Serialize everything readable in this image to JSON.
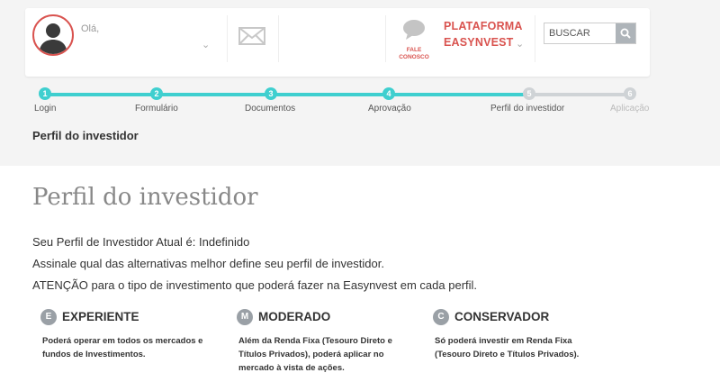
{
  "header": {
    "greeting": "Olá,",
    "chat_label_line1": "FALE",
    "chat_label_line2": "CONOSCO",
    "platform_line1": "PLATAFORMA",
    "platform_line2": "EASYNVEST",
    "search_placeholder": "BUSCAR",
    "accent_color": "#d9534f"
  },
  "stepper": {
    "progress_color": "#3fcfcf",
    "inactive_color": "#cfd3d6",
    "steps": [
      {
        "number": "1",
        "label": "Login",
        "state": "done"
      },
      {
        "number": "2",
        "label": "Formulário",
        "state": "done"
      },
      {
        "number": "3",
        "label": "Documentos",
        "state": "done"
      },
      {
        "number": "4",
        "label": "Aprovação",
        "state": "done"
      },
      {
        "number": "5",
        "label": "Perfil do investidor",
        "state": "current"
      },
      {
        "number": "6",
        "label": "Aplicação",
        "state": "pending"
      }
    ],
    "current_title": "Perfil do investidor"
  },
  "main": {
    "title": "Perfil do investidor",
    "current_profile": "Seu Perfil de Investidor Atual é: Indefinido",
    "instruction": "Assinale qual das alternativas melhor define seu perfil de investidor.",
    "attention": "ATENÇÃO para o tipo de investimento que poderá fazer na Easynvest em cada perfil."
  },
  "profiles": [
    {
      "letter": "E",
      "name": "EXPERIENTE",
      "description": "Poderá operar em todos os mercados e fundos de Investimentos."
    },
    {
      "letter": "M",
      "name": "MODERADO",
      "description": "Além da Renda Fixa (Tesouro Direto e Títulos Privados), poderá aplicar no mercado à vista de ações."
    },
    {
      "letter": "C",
      "name": "CONSERVADOR",
      "description": "Só poderá investir em Renda Fixa (Tesouro Direto e Títulos Privados)."
    }
  ]
}
